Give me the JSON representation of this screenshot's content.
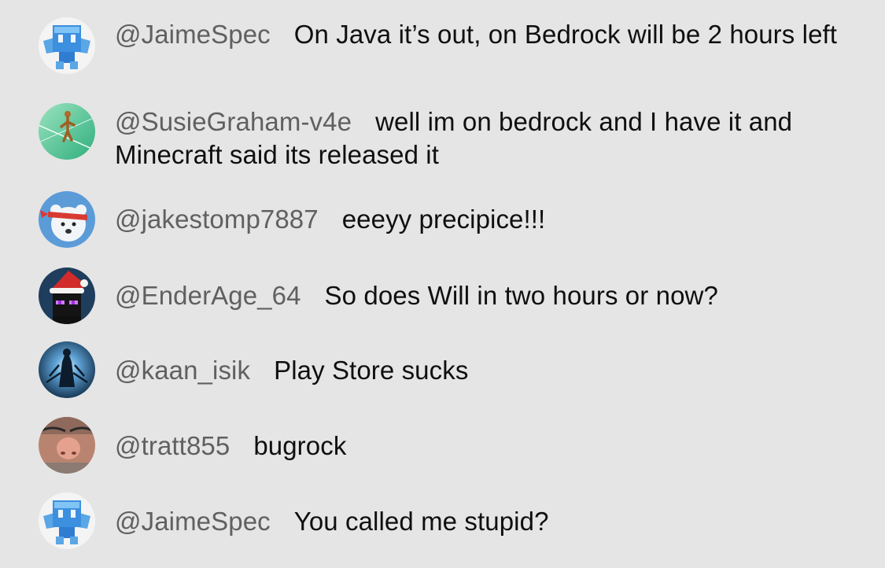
{
  "chat": {
    "messages": [
      {
        "author": "@JaimeSpec",
        "text": "On Java it’s out, on Bedrock will be 2 hours left",
        "avatar_icon": "blue-allay-avatar-icon"
      },
      {
        "author": "@SusieGraham-v4e",
        "text": "well im on bedrock and I have it and Minecraft said its released it",
        "avatar_icon": "tightrope-walker-avatar-icon"
      },
      {
        "author": "@jakestomp7887",
        "text": "eeeyy precipice!!!",
        "avatar_icon": "polar-bear-headband-avatar-icon"
      },
      {
        "author": "@EnderAge_64",
        "text": "So does Will in two hours or now?",
        "avatar_icon": "enderman-santa-hat-avatar-icon"
      },
      {
        "author": "@kaan_isik",
        "text": "Play Store sucks",
        "avatar_icon": "dark-figure-avatar-icon"
      },
      {
        "author": "@tratt855",
        "text": "bugrock",
        "avatar_icon": "face-closeup-avatar-icon"
      },
      {
        "author": "@JaimeSpec",
        "text": "You called me stupid?",
        "avatar_icon": "blue-allay-avatar-icon"
      }
    ]
  },
  "colors": {
    "background": "#e5e5e5",
    "author": "#606060",
    "text": "#0f0f0f"
  }
}
